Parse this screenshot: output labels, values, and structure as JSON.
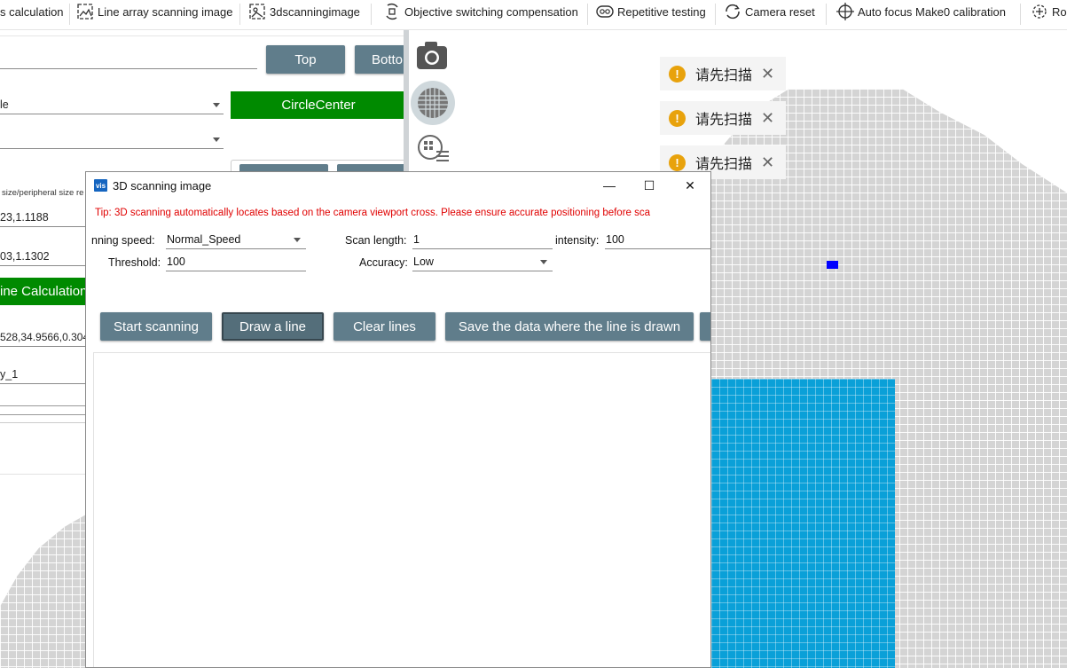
{
  "toolbar": {
    "items": [
      {
        "label": "s calculation",
        "icon": "calculation-icon"
      },
      {
        "label": "Line array scanning image",
        "icon": "line-scan-image-icon"
      },
      {
        "label": "3dscanningimage",
        "icon": "3d-scan-image-icon"
      },
      {
        "label": "Objective switching compensation",
        "icon": "objective-switch-icon"
      },
      {
        "label": "Repetitive testing",
        "icon": "repeat-icon"
      },
      {
        "label": "Camera reset",
        "icon": "reset-icon"
      },
      {
        "label": "Auto focus Make0 calibration",
        "icon": "crosshair-icon"
      },
      {
        "label": "Ro",
        "icon": "rotate-icon"
      }
    ]
  },
  "panel": {
    "top_button": "Top",
    "bottom_button": "Botto",
    "select1_value": "le",
    "circle_center_button": "CircleCenter",
    "size_label": "size/peripheral size re",
    "value1": "23,1.1188",
    "value2": "03,1.1302",
    "line_calc_button": "ine Calculation",
    "coords_value": "528,34.9566,0.304",
    "name_value": "y_1"
  },
  "notifications": [
    {
      "text": "请先扫描"
    },
    {
      "text": "请先扫描"
    },
    {
      "text": "请先扫描"
    }
  ],
  "dialog": {
    "app_icon_text": "vis",
    "title": "3D scanning image",
    "minimize": "—",
    "maximize": "☐",
    "close": "✕",
    "tip": "Tip: 3D scanning automatically locates based on the camera viewport cross. Please ensure accurate positioning before sca",
    "scan_speed_label": "nning speed:",
    "scan_speed_value": "Normal_Speed",
    "scan_length_label": "Scan length:",
    "scan_length_value": "1",
    "intensity_label": "intensity:",
    "intensity_value": "100",
    "threshold_label": "Threshold:",
    "threshold_value": "100",
    "accuracy_label": "Accuracy:",
    "accuracy_value": "Low",
    "buttons": {
      "start": "Start scanning",
      "draw": "Draw a line",
      "clear": "Clear lines",
      "save": "Save the data where the line is drawn"
    }
  },
  "colors": {
    "button_grey": "#607d8b",
    "button_green": "#008a00",
    "grid_grey": "#d4d4d4",
    "selected_blue": "#0aa0d8",
    "tip_red": "#e00000",
    "warning": "#e8a20c"
  }
}
